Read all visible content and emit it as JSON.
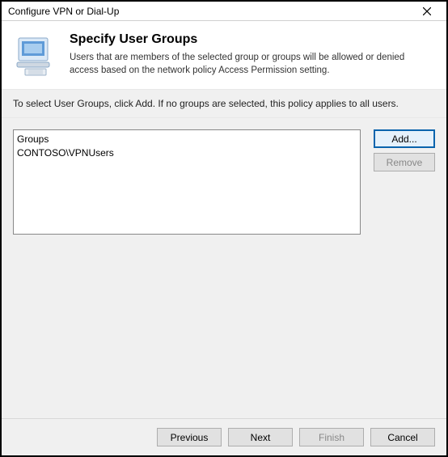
{
  "window": {
    "title": "Configure VPN or Dial-Up"
  },
  "header": {
    "heading": "Specify User Groups",
    "description": "Users that are members of the selected group or groups will be allowed or denied access based on the network policy Access Permission setting."
  },
  "instruction": "To select User Groups, click Add. If no groups are selected, this policy applies to all users.",
  "groups": {
    "column_header": "Groups",
    "items": [
      "CONTOSO\\VPNUsers"
    ]
  },
  "side_buttons": {
    "add": "Add...",
    "remove": "Remove"
  },
  "wizard": {
    "previous": "Previous",
    "next": "Next",
    "finish": "Finish",
    "cancel": "Cancel"
  }
}
